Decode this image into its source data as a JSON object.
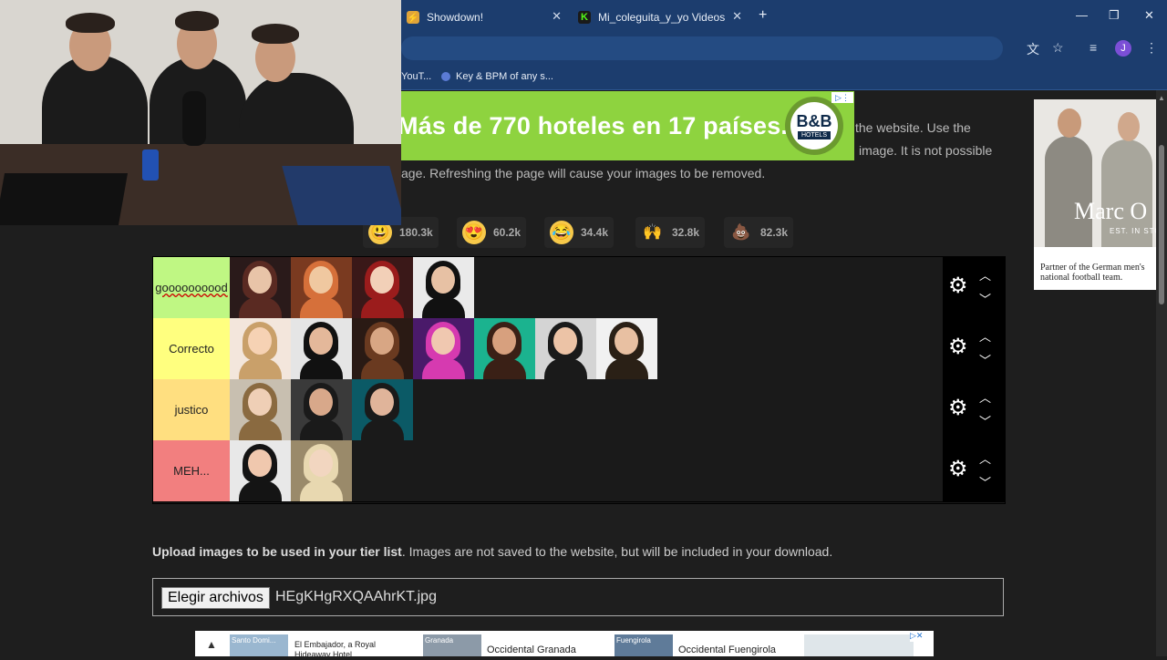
{
  "browser": {
    "tabs": [
      {
        "title": "Showdown!",
        "close": "✕"
      },
      {
        "title": "Mi_coleguita_y_yo Videos - Wat",
        "close": "✕"
      }
    ],
    "new_tab": "+",
    "window_controls": {
      "minimize": "—",
      "restore": "❐",
      "close": "✕"
    },
    "avatar_letter": "J",
    "bookmarks": [
      "YouT...",
      "Key & BPM of any s..."
    ]
  },
  "ad_banner": {
    "text": "Más de 770 hoteles en 17 países.",
    "logo_main": "B&B",
    "logo_sub": "HOTELS",
    "color": "#8ed33f"
  },
  "intro": {
    "line1": "the website. Use the",
    "line2": "image. It is not possible",
    "line3": "age. Refreshing the page will cause your images to be removed."
  },
  "reactions": [
    {
      "emoji": "😃",
      "count": "180.3k"
    },
    {
      "emoji": "😍",
      "count": "60.2k"
    },
    {
      "emoji": "😂",
      "count": "34.4k"
    },
    {
      "emoji": "🙌",
      "count": "32.8k"
    },
    {
      "emoji": "💩",
      "count": "82.3k"
    }
  ],
  "tiers": [
    {
      "label": "goooooooood",
      "color": "#bff783",
      "item_count": 4
    },
    {
      "label": "Correcto",
      "color": "#ffff7f",
      "item_count": 7
    },
    {
      "label": "justico",
      "color": "#ffdf80",
      "item_count": 3
    },
    {
      "label": "MEH...",
      "color": "#f27f7f",
      "item_count": 2
    }
  ],
  "upload": {
    "bold": "Upload images to be used in your tier list",
    "rest": ". Images are not saved to the website, but will be included in your download.",
    "button": "Elegir archivos",
    "filename": "HEgKHgRXQAAhrKT.jpg"
  },
  "side_ad": {
    "brand": "Marc O",
    "brand_sub": "EST. IN STO",
    "caption": "Partner of the German men's national football team."
  },
  "bottom_ad": {
    "items": [
      {
        "thumb_label": "Santo Domi...",
        "name": "El Embajador, a Royal Hideaway Hotel"
      },
      {
        "thumb_label": "Granada",
        "name": "Occidental Granada"
      },
      {
        "thumb_label": "Fuengirola",
        "name": "Occidental Fuengirola"
      }
    ]
  }
}
